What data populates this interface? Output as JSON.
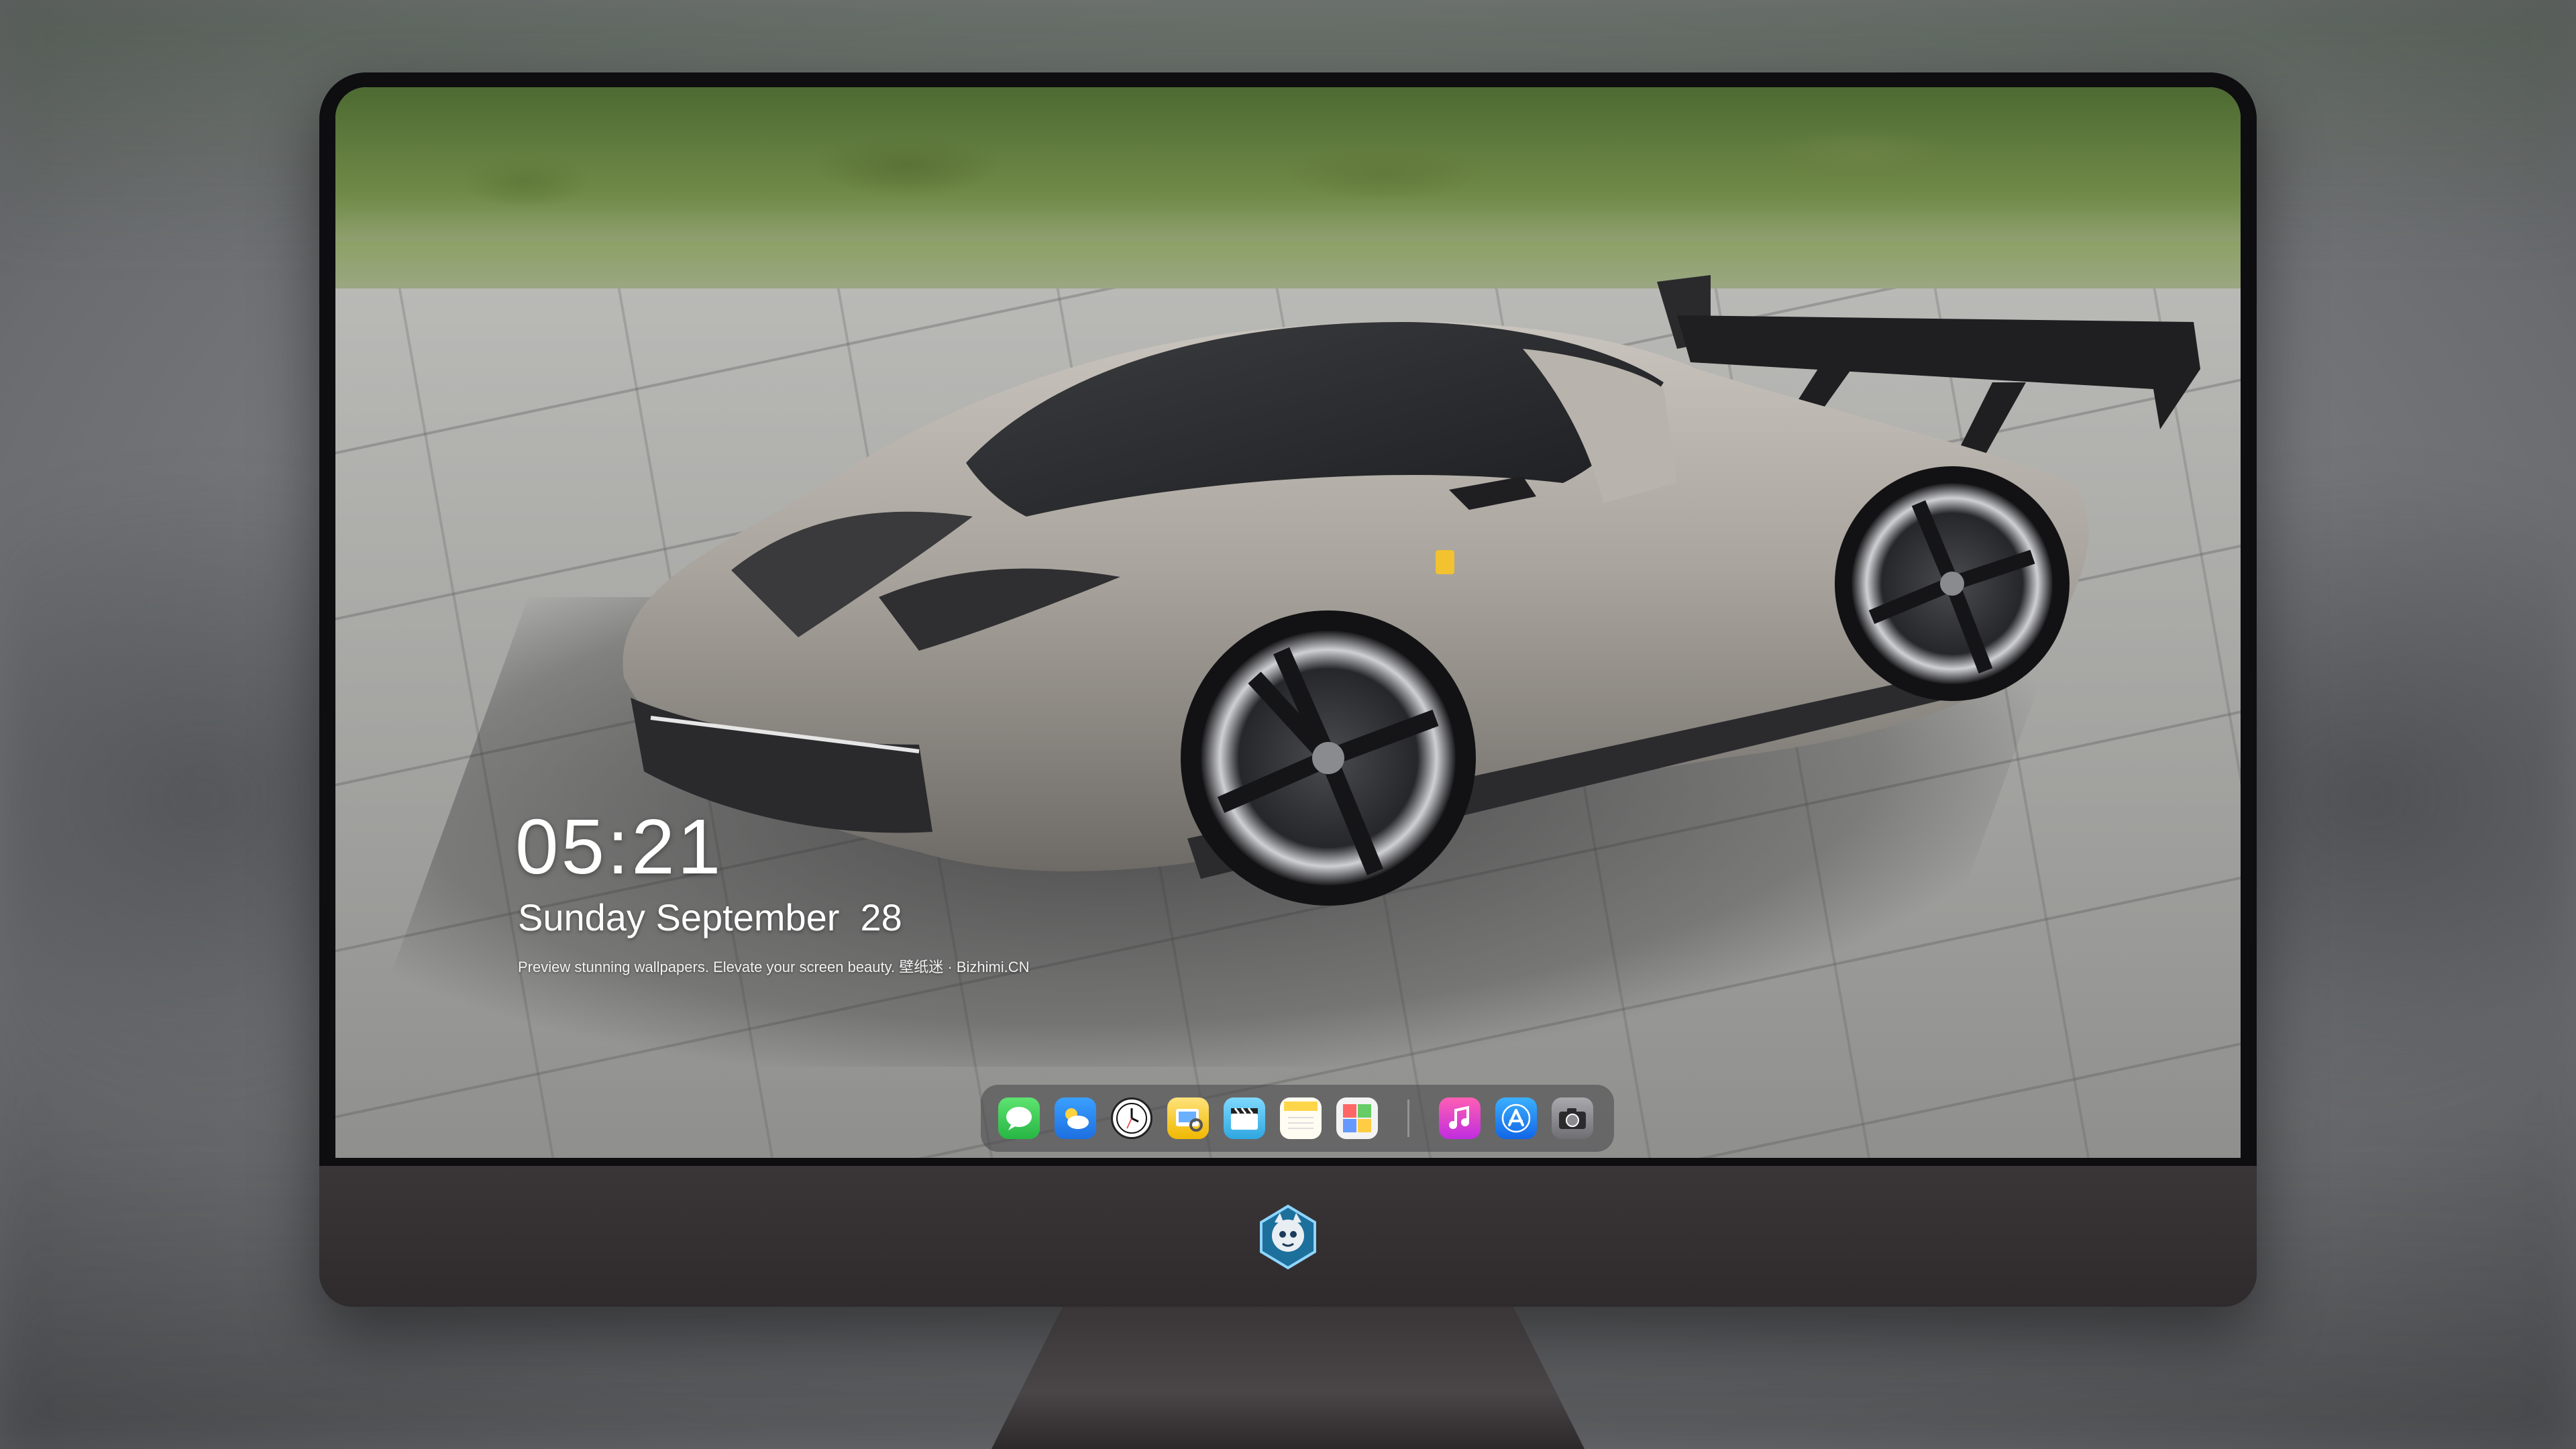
{
  "lockscreen": {
    "time": "05:21",
    "date": "Sunday September  28",
    "tagline": "Preview stunning wallpapers. Elevate your screen beauty. 壁纸迷 · Bizhimi.CN"
  },
  "dock": {
    "apps": [
      {
        "name": "Messages",
        "icon": "messages-icon",
        "color": "#34c759"
      },
      {
        "name": "Weather",
        "icon": "weather-icon",
        "color": "#2f8cf5"
      },
      {
        "name": "Clock",
        "icon": "clock-icon",
        "color": "#ffffff"
      },
      {
        "name": "Preview",
        "icon": "preview-icon",
        "color": "#ffd64a"
      },
      {
        "name": "Clips",
        "icon": "clips-icon",
        "color": "#5ac8fa"
      },
      {
        "name": "Notes",
        "icon": "notes-icon",
        "color": "#ffd54a"
      },
      {
        "name": "Photo Booth",
        "icon": "photo-booth-icon",
        "color": "#f2f2f2"
      }
    ],
    "pinned": [
      {
        "name": "Music",
        "icon": "music-icon",
        "color": "#fa2d8f"
      },
      {
        "name": "App Store",
        "icon": "app-store-icon",
        "color": "#1e8fff"
      },
      {
        "name": "Camera",
        "icon": "camera-icon",
        "color": "#8e8e93"
      }
    ]
  },
  "monitor": {
    "chin_logo": "mascot-logo-icon"
  }
}
